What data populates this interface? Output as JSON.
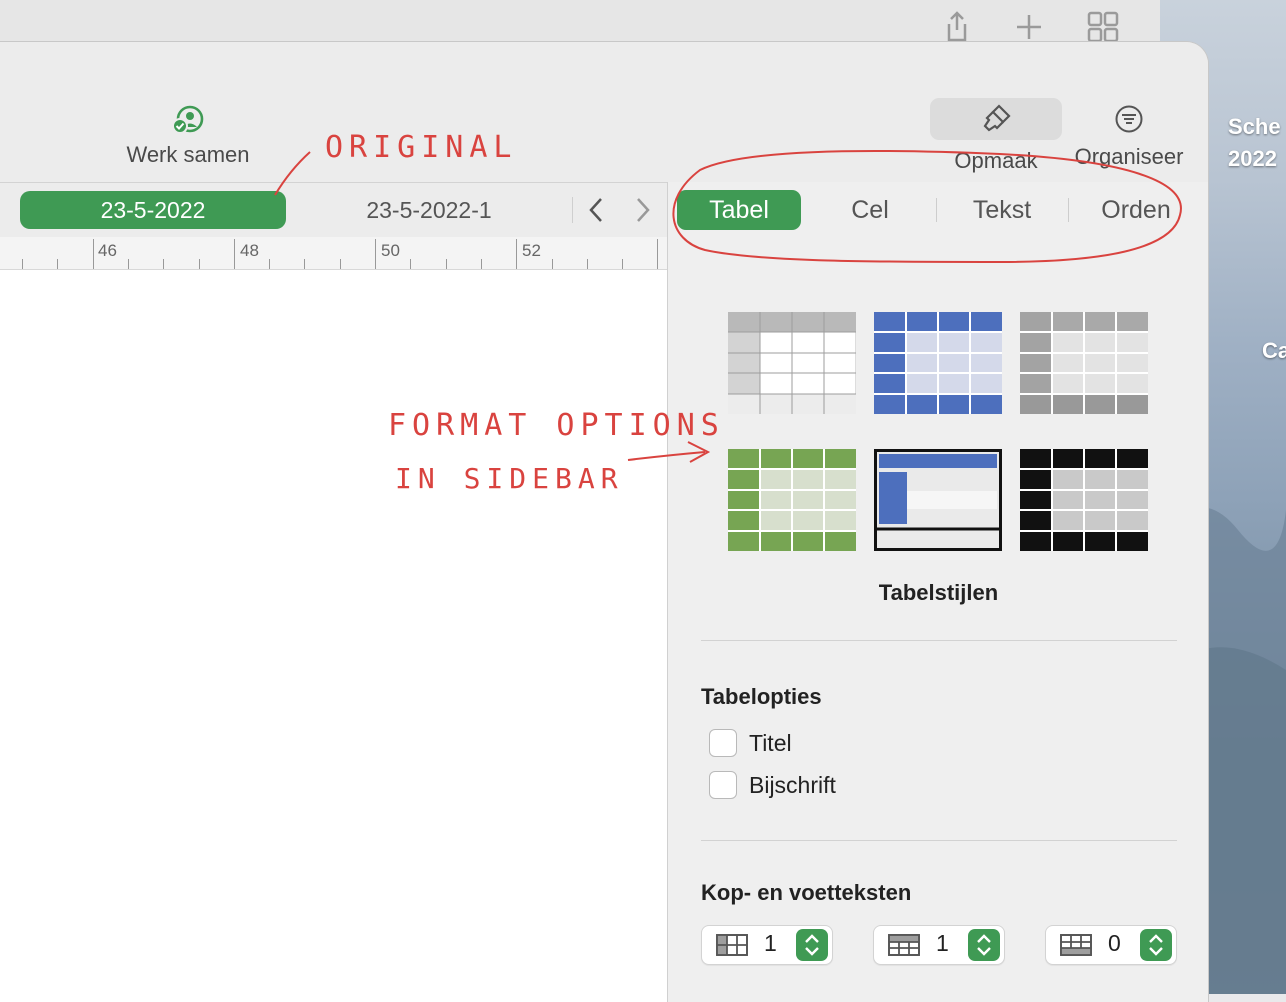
{
  "desktop": {
    "label_top": "Sche",
    "label_bottom": "2022",
    "label_lower": "Ca"
  },
  "toolbar": {
    "collaborate_label": "Werk samen",
    "format_label": "Opmaak",
    "organize_label": "Organiseer"
  },
  "sheets": {
    "tabs": [
      {
        "label": "23-5-2022",
        "active": true
      },
      {
        "label": "23-5-2022-1",
        "active": false
      }
    ]
  },
  "ruler": {
    "marks": [
      "46",
      "48",
      "50",
      "52"
    ]
  },
  "sidebar": {
    "segments": [
      {
        "label": "Tabel",
        "active": true
      },
      {
        "label": "Cel",
        "active": false
      },
      {
        "label": "Tekst",
        "active": false
      },
      {
        "label": "Orden",
        "active": false
      }
    ],
    "table_styles_label": "Tabelstijlen",
    "table_options": {
      "title": "Tabelopties",
      "options": [
        {
          "label": "Titel",
          "checked": false
        },
        {
          "label": "Bijschrift",
          "checked": false
        }
      ]
    },
    "headers_footers": {
      "title": "Kop- en voetteksten",
      "header_rows": "1",
      "header_columns": "1",
      "footer_rows": "0"
    }
  },
  "annotations": {
    "original": "ORIGINAL",
    "format_line1": "FORMAT OPTIONS",
    "format_line2": "IN SIDEBAR"
  },
  "colors": {
    "accent_green": "#3f9a54",
    "annotation_red": "#d9433f"
  }
}
